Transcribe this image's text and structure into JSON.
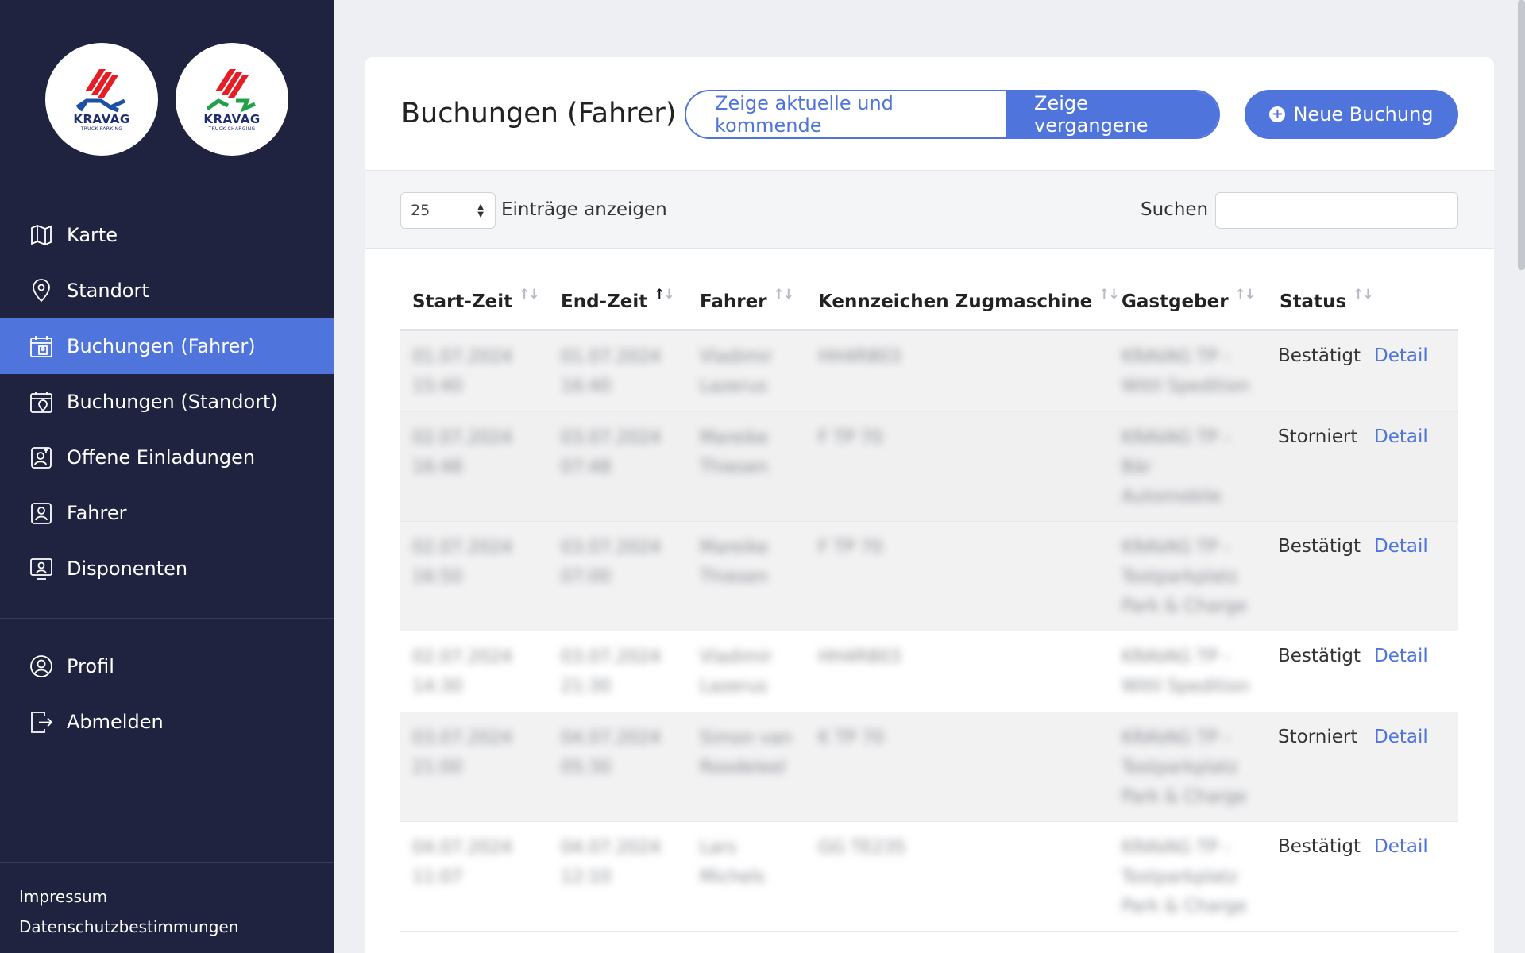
{
  "logos": [
    {
      "brand": "KRAVAG",
      "sub": "TRUCK PARKING",
      "accent": "#1d4fa3"
    },
    {
      "brand": "KRAVAG",
      "sub": "TRUCK CHARGING",
      "accent": "#21a24a"
    }
  ],
  "nav": {
    "items": [
      {
        "label": "Karte",
        "icon": "map-icon"
      },
      {
        "label": "Standort",
        "icon": "location-pin-icon"
      },
      {
        "label": "Buchungen (Fahrer)",
        "icon": "calendar-user-icon",
        "active": true
      },
      {
        "label": "Buchungen (Standort)",
        "icon": "calendar-pin-icon"
      },
      {
        "label": "Offene Einladungen",
        "icon": "user-plus-icon"
      },
      {
        "label": "Fahrer",
        "icon": "user-badge-icon"
      },
      {
        "label": "Disponenten",
        "icon": "user-screen-icon"
      }
    ],
    "secondary": [
      {
        "label": "Profil",
        "icon": "user-circle-icon"
      },
      {
        "label": "Abmelden",
        "icon": "logout-icon"
      }
    ]
  },
  "footer": {
    "impressum": "Impressum",
    "datenschutz": "Datenschutzbestimmungen"
  },
  "header": {
    "title": "Buchungen (Fahrer)",
    "toggle_current": "Zeige aktuelle und kommende",
    "toggle_past": "Zeige vergangene",
    "new_button": "Neue Buchung"
  },
  "toolbar": {
    "page_size": "25",
    "entries_label": "Einträge anzeigen",
    "search_label": "Suchen",
    "search_value": ""
  },
  "table": {
    "columns": [
      "Start-Zeit",
      "End-Zeit",
      "Fahrer",
      "Kennzeichen Zugmaschine",
      "Gastgeber",
      "Status"
    ],
    "sorted_column": "End-Zeit",
    "sort_direction": "ascending",
    "detail_label": "Detail",
    "rows": [
      {
        "start": [
          "01.07.2024",
          "15:40"
        ],
        "end": [
          "01.07.2024",
          "16:40"
        ],
        "fahrer": [
          "Vladimir",
          "Lazerus"
        ],
        "kennzeichen": "HH4R803",
        "gastgeber": [
          "KRAVAG TP -",
          "Wittl Spedition"
        ],
        "status": "Bestätigt"
      },
      {
        "start": [
          "02.07.2024",
          "16:48"
        ],
        "end": [
          "03.07.2024",
          "07:48"
        ],
        "fahrer": [
          "Mareike",
          "Thiesen"
        ],
        "kennzeichen": "F TP 70",
        "gastgeber": [
          "KRAVAG TP -",
          "Bär",
          "Automobile"
        ],
        "status": "Storniert"
      },
      {
        "start": [
          "02.07.2024",
          "16:50"
        ],
        "end": [
          "03.07.2024",
          "07:00"
        ],
        "fahrer": [
          "Mareike",
          "Thiesen"
        ],
        "kennzeichen": "F TP 70",
        "gastgeber": [
          "KRAVAG TP -",
          "Tostparkplatz",
          "Park & Charge"
        ],
        "status": "Bestätigt"
      },
      {
        "start": [
          "02.07.2024",
          "14:30"
        ],
        "end": [
          "03.07.2024",
          "21:30"
        ],
        "fahrer": [
          "Vladimir",
          "Lazerus"
        ],
        "kennzeichen": "HH4R803",
        "gastgeber": [
          "KRAVAG TP -",
          "Wittl Spedition"
        ],
        "status": "Bestätigt"
      },
      {
        "start": [
          "03.07.2024",
          "21:00"
        ],
        "end": [
          "04.07.2024",
          "05:30"
        ],
        "fahrer": [
          "Simon van",
          "Roodeleel"
        ],
        "kennzeichen": "K TP 70",
        "gastgeber": [
          "KRAVAG TP -",
          "Tostparkplatz",
          "Park & Charge"
        ],
        "status": "Storniert"
      },
      {
        "start": [
          "04.07.2024",
          "11:07"
        ],
        "end": [
          "04.07.2024",
          "12:10"
        ],
        "fahrer": [
          "Lars",
          "Michels"
        ],
        "kennzeichen": "GG TE235",
        "gastgeber": [
          "KRAVAG TP -",
          "Tostparkplatz",
          "Park & Charge"
        ],
        "status": "Bestätigt"
      }
    ]
  },
  "colors": {
    "accent": "#4f74dc",
    "sidebar": "#1f2340",
    "red": "#e31e24"
  }
}
